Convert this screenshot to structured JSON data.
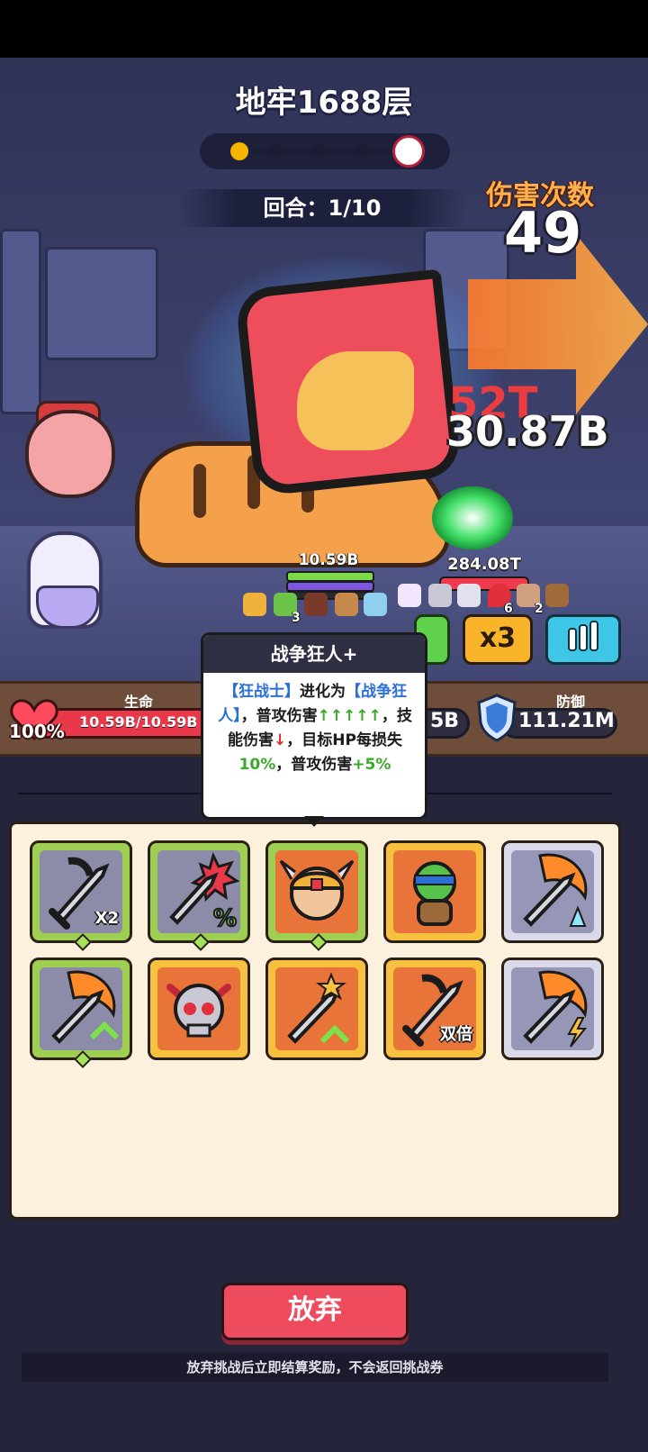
{
  "header": {
    "title": "地牢1688层",
    "round": "回合：1/10"
  },
  "battle": {
    "hits_label": "伤害次数",
    "hits_value": "49",
    "damage_numbers": [
      "52T",
      "30.87B"
    ],
    "hero_hp_label": "10.59B",
    "boss_hp_label": "284.08T",
    "buff_counts": [
      "3",
      "6",
      "2"
    ],
    "speed_button": "x3"
  },
  "stats": {
    "life_label": "生命",
    "life_value": "10.59B/10.59B",
    "life_percent": "100%",
    "attack_value_partial": "5B",
    "defense_label": "防御",
    "defense_value": "111.21M"
  },
  "tooltip": {
    "title": "战争狂人+",
    "line1_a": "【狂战士】",
    "line1_b": "进化为",
    "line1_c": "【战争狂人】",
    "line2_a": "，普攻伤害",
    "line2_b": "↑↑↑↑↑",
    "line3_a": "，技能伤害",
    "line3_b": "↓",
    "line3_c": "，目标HP每损失",
    "line3_d": "10%",
    "line3_e": "，普攻伤害",
    "line3_f": "+5%"
  },
  "skills": [
    {
      "name": "sword-x2",
      "tag": "X2",
      "frame": "green",
      "icon": "sword-icon"
    },
    {
      "name": "sword-crit-percent",
      "tag": "",
      "frame": "green",
      "icon": "sword-icon"
    },
    {
      "name": "viking-hero",
      "tag": "",
      "frame": "green",
      "icon": "viking-icon"
    },
    {
      "name": "ninja-turtle",
      "tag": "",
      "frame": "orange",
      "icon": "turtle-icon"
    },
    {
      "name": "flame-sword-ice",
      "tag": "",
      "frame": "gray",
      "icon": "flame-sword-icon"
    },
    {
      "name": "flame-sword-up",
      "tag": "",
      "frame": "green",
      "icon": "flame-sword-icon"
    },
    {
      "name": "demon-skull",
      "tag": "",
      "frame": "orange",
      "icon": "skull-icon"
    },
    {
      "name": "star-sword",
      "tag": "",
      "frame": "orange",
      "icon": "sword-icon"
    },
    {
      "name": "sword-double",
      "tag": "双倍",
      "frame": "orange",
      "icon": "sword-icon"
    },
    {
      "name": "flame-sword-lightning",
      "tag": "",
      "frame": "gray",
      "icon": "flame-sword-icon"
    }
  ],
  "footer": {
    "abandon_button": "放弃",
    "note": "放弃挑战后立即结算奖励，不会返回挑战券"
  },
  "colors": {
    "accent_red": "#ee4b5e",
    "accent_orange": "#f9b42a",
    "accent_blue": "#3fc7e8",
    "panel_bg": "#fbf1dc"
  }
}
